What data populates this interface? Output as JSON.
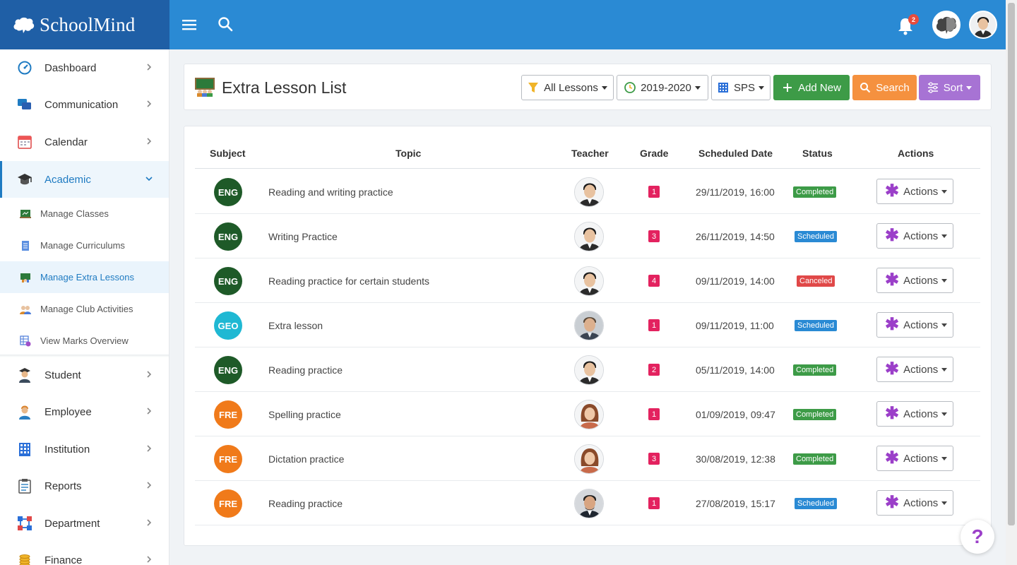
{
  "app": {
    "logo_text": "SchoolMind"
  },
  "topbar": {
    "notification_count": "2"
  },
  "sidebar": {
    "items": [
      {
        "label": "Dashboard",
        "icon": "dashboard-icon"
      },
      {
        "label": "Communication",
        "icon": "chat-icon"
      },
      {
        "label": "Calendar",
        "icon": "calendar-icon"
      },
      {
        "label": "Academic",
        "icon": "graduation-cap-icon"
      },
      {
        "label": "Student",
        "icon": "student-icon"
      },
      {
        "label": "Employee",
        "icon": "employee-icon"
      },
      {
        "label": "Institution",
        "icon": "building-icon"
      },
      {
        "label": "Reports",
        "icon": "clipboard-icon"
      },
      {
        "label": "Department",
        "icon": "department-icon"
      },
      {
        "label": "Finance",
        "icon": "coins-icon"
      }
    ],
    "academic_sub": [
      {
        "label": "Manage Classes",
        "icon": "chalkboard-icon"
      },
      {
        "label": "Manage Curriculums",
        "icon": "document-icon"
      },
      {
        "label": "Manage Extra Lessons",
        "icon": "lesson-board-icon"
      },
      {
        "label": "Manage Club Activities",
        "icon": "group-icon"
      },
      {
        "label": "View Marks Overview",
        "icon": "marks-grid-icon"
      }
    ]
  },
  "header": {
    "title": "Extra Lesson List",
    "filter_label": "All Lessons",
    "year_label": "2019-2020",
    "school_label": "SPS",
    "add_label": "Add New",
    "search_label": "Search",
    "sort_label": "Sort"
  },
  "table": {
    "columns": [
      "Subject",
      "Topic",
      "Teacher",
      "Grade",
      "Scheduled Date",
      "Status",
      "Actions"
    ],
    "action_label": "Actions",
    "rows": [
      {
        "subject": "ENG",
        "topic": "Reading and writing practice",
        "grade": "1",
        "date": "29/11/2019, 16:00",
        "status": "Completed"
      },
      {
        "subject": "ENG",
        "topic": "Writing Practice",
        "grade": "3",
        "date": "26/11/2019, 14:50",
        "status": "Scheduled"
      },
      {
        "subject": "ENG",
        "topic": "Reading practice for certain students",
        "grade": "4",
        "date": "09/11/2019, 14:00",
        "status": "Canceled"
      },
      {
        "subject": "GEO",
        "topic": "Extra lesson",
        "grade": "1",
        "date": "09/11/2019, 11:00",
        "status": "Scheduled"
      },
      {
        "subject": "ENG",
        "topic": "Reading practice",
        "grade": "2",
        "date": "05/11/2019, 14:00",
        "status": "Completed"
      },
      {
        "subject": "FRE",
        "topic": "Spelling practice",
        "grade": "1",
        "date": "01/09/2019, 09:47",
        "status": "Completed"
      },
      {
        "subject": "FRE",
        "topic": "Dictation practice",
        "grade": "3",
        "date": "30/08/2019, 12:38",
        "status": "Completed"
      },
      {
        "subject": "FRE",
        "topic": "Reading practice",
        "grade": "1",
        "date": "27/08/2019, 15:17",
        "status": "Scheduled"
      }
    ]
  },
  "help": {
    "label": "?"
  },
  "colors": {
    "topbar": "#2a8ad4",
    "logo_bg": "#1f5fa6",
    "ENG": "#1e5a28",
    "GEO": "#1fb8d3",
    "FRE": "#f07a1a",
    "Completed": "#3d9b47",
    "Scheduled": "#2a8ad4",
    "Canceled": "#e04848",
    "grade_badge": "#e3225f"
  }
}
